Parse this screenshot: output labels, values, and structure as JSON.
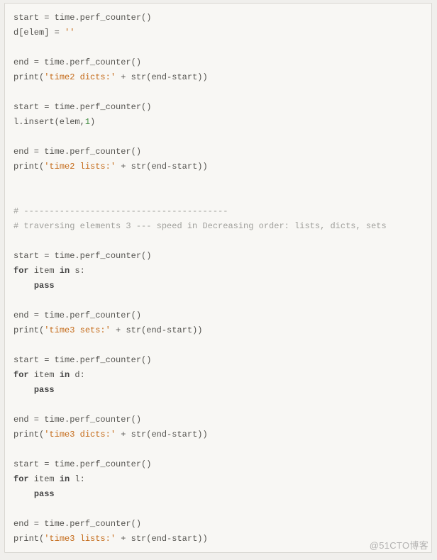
{
  "watermark": "@51CTO博客",
  "code": {
    "lines": [
      [
        {
          "t": "default",
          "v": "start = time.perf_counter()"
        }
      ],
      [
        {
          "t": "default",
          "v": "d[elem] = "
        },
        {
          "t": "str",
          "v": "''"
        }
      ],
      [],
      [
        {
          "t": "default",
          "v": "end = time.perf_counter()"
        }
      ],
      [
        {
          "t": "default",
          "v": "print("
        },
        {
          "t": "str",
          "v": "'time2 dicts:'"
        },
        {
          "t": "default",
          "v": " + str(end-start))"
        }
      ],
      [],
      [
        {
          "t": "default",
          "v": "start = time.perf_counter()"
        }
      ],
      [
        {
          "t": "default",
          "v": "l.insert(elem,"
        },
        {
          "t": "num",
          "v": "1"
        },
        {
          "t": "default",
          "v": ")"
        }
      ],
      [],
      [
        {
          "t": "default",
          "v": "end = time.perf_counter()"
        }
      ],
      [
        {
          "t": "default",
          "v": "print("
        },
        {
          "t": "str",
          "v": "'time2 lists:'"
        },
        {
          "t": "default",
          "v": " + str(end-start))"
        }
      ],
      [],
      [],
      [
        {
          "t": "comment",
          "v": "# ----------------------------------------"
        }
      ],
      [
        {
          "t": "comment",
          "v": "# traversing elements 3 --- speed in Decreasing order: lists, dicts, sets"
        }
      ],
      [],
      [
        {
          "t": "default",
          "v": "start = time.perf_counter()"
        }
      ],
      [
        {
          "t": "kw",
          "v": "for"
        },
        {
          "t": "default",
          "v": " item "
        },
        {
          "t": "kw",
          "v": "in"
        },
        {
          "t": "default",
          "v": " s:"
        }
      ],
      [
        {
          "t": "default",
          "v": "    "
        },
        {
          "t": "kw",
          "v": "pass"
        }
      ],
      [],
      [
        {
          "t": "default",
          "v": "end = time.perf_counter()"
        }
      ],
      [
        {
          "t": "default",
          "v": "print("
        },
        {
          "t": "str",
          "v": "'time3 sets:'"
        },
        {
          "t": "default",
          "v": " + str(end-start))"
        }
      ],
      [],
      [
        {
          "t": "default",
          "v": "start = time.perf_counter()"
        }
      ],
      [
        {
          "t": "kw",
          "v": "for"
        },
        {
          "t": "default",
          "v": " item "
        },
        {
          "t": "kw",
          "v": "in"
        },
        {
          "t": "default",
          "v": " d:"
        }
      ],
      [
        {
          "t": "default",
          "v": "    "
        },
        {
          "t": "kw",
          "v": "pass"
        }
      ],
      [],
      [
        {
          "t": "default",
          "v": "end = time.perf_counter()"
        }
      ],
      [
        {
          "t": "default",
          "v": "print("
        },
        {
          "t": "str",
          "v": "'time3 dicts:'"
        },
        {
          "t": "default",
          "v": " + str(end-start))"
        }
      ],
      [],
      [
        {
          "t": "default",
          "v": "start = time.perf_counter()"
        }
      ],
      [
        {
          "t": "kw",
          "v": "for"
        },
        {
          "t": "default",
          "v": " item "
        },
        {
          "t": "kw",
          "v": "in"
        },
        {
          "t": "default",
          "v": " l:"
        }
      ],
      [
        {
          "t": "default",
          "v": "    "
        },
        {
          "t": "kw",
          "v": "pass"
        }
      ],
      [],
      [
        {
          "t": "default",
          "v": "end = time.perf_counter()"
        }
      ],
      [
        {
          "t": "default",
          "v": "print("
        },
        {
          "t": "str",
          "v": "'time3 lists:'"
        },
        {
          "t": "default",
          "v": " + str(end-start))"
        }
      ]
    ]
  }
}
